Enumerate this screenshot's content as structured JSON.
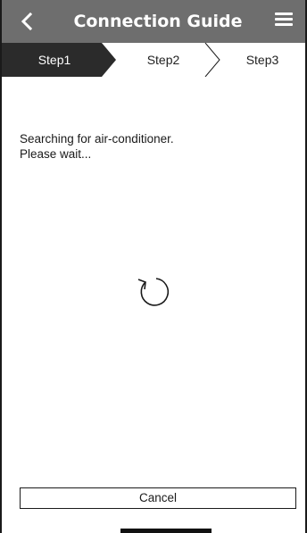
{
  "header": {
    "title": "Connection Guide",
    "back_icon": "chevron-left-icon",
    "menu_icon": "hamburger-menu-icon",
    "background_color": "#6e6e6e"
  },
  "steps": {
    "items": [
      {
        "label": "Step1",
        "active": true
      },
      {
        "label": "Step2",
        "active": false
      },
      {
        "label": "Step3",
        "active": false
      }
    ],
    "active_color": "#2b2b2b"
  },
  "message": {
    "line1": "Searching for air-conditioner.",
    "line2": "Please wait..."
  },
  "spinner_icon": "refresh-spinner-icon",
  "cancel_label": "Cancel"
}
